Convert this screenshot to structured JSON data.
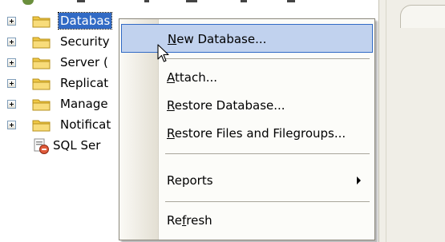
{
  "tree": {
    "items": [
      {
        "label": "Databas",
        "selected": true
      },
      {
        "label": "Security",
        "selected": false
      },
      {
        "label": "Server (",
        "selected": false
      },
      {
        "label": "Replicat",
        "selected": false
      },
      {
        "label": "Manage",
        "selected": false
      },
      {
        "label": "Notificat",
        "selected": false
      }
    ],
    "sql_item": {
      "label": "SQL Ser"
    }
  },
  "context_menu": {
    "items": [
      {
        "pre": "",
        "ul": "N",
        "post": "ew Database...",
        "highlighted": true,
        "submenu": false
      },
      {
        "pre": "",
        "ul": "A",
        "post": "ttach...",
        "highlighted": false,
        "submenu": false
      },
      {
        "pre": "",
        "ul": "R",
        "post": "estore Database...",
        "highlighted": false,
        "submenu": false
      },
      {
        "pre": "",
        "ul": "R",
        "post": "estore Files and Filegroups...",
        "highlighted": false,
        "submenu": false
      },
      {
        "pre": "Reports",
        "ul": "",
        "post": "",
        "highlighted": false,
        "submenu": true
      },
      {
        "pre": "Re",
        "ul": "f",
        "post": "resh",
        "highlighted": false,
        "submenu": false
      }
    ]
  },
  "colors": {
    "selection_blue": "#316ac5",
    "menu_highlight": "#c1d2ee",
    "folder_yellow": "#f0c846"
  },
  "icons": {
    "expander": "plus-box-icon",
    "folder": "folder-icon",
    "sql_agent": "sql-server-agent-icon",
    "submenu": "submenu-arrow-icon",
    "cursor": "mouse-pointer-icon"
  }
}
